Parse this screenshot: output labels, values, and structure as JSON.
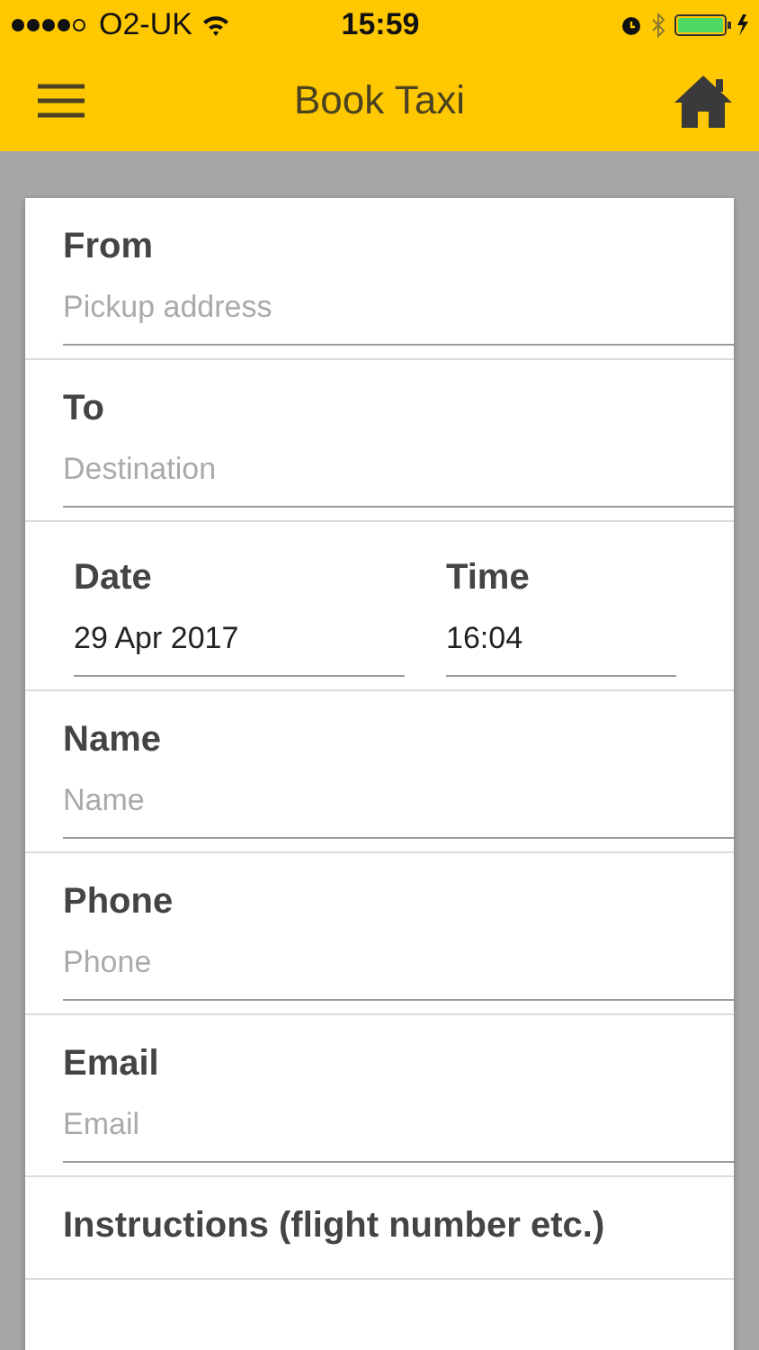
{
  "status_bar": {
    "carrier": "O2-UK",
    "time": "15:59"
  },
  "header": {
    "title": "Book Taxi"
  },
  "sections": [
    {
      "kind": "single",
      "label": "From",
      "placeholder": "Pickup address"
    },
    {
      "kind": "single",
      "label": "To",
      "placeholder": "Destination"
    },
    {
      "kind": "pair",
      "fields": [
        {
          "label": "Date",
          "value": "29 Apr 2017"
        },
        {
          "label": "Time",
          "value": "16:04"
        }
      ]
    },
    {
      "kind": "single",
      "label": "Name",
      "placeholder": "Name"
    },
    {
      "kind": "single",
      "label": "Phone",
      "placeholder": "Phone"
    },
    {
      "kind": "single",
      "label": "Email",
      "placeholder": "Email"
    },
    {
      "kind": "single",
      "label": "Instructions (flight number etc.)"
    }
  ]
}
